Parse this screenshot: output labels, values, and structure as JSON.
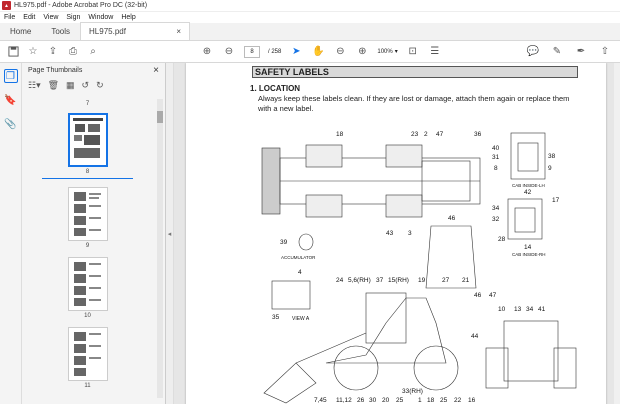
{
  "window": {
    "title": "HL975.pdf - Adobe Acrobat Pro DC (32-bit)",
    "app_icon": "pdf-icon"
  },
  "menu": [
    "File",
    "Edit",
    "View",
    "Sign",
    "Window",
    "Help"
  ],
  "tabs": {
    "home": "Home",
    "tools": "Tools",
    "doc": "HL975.pdf",
    "close": "×"
  },
  "toolbar": {
    "page_current": "8",
    "page_total": "/ 258",
    "zoom": "100%"
  },
  "thumbnails": {
    "title": "Page Thumbnails",
    "close": "×",
    "pages": [
      {
        "label": "7"
      },
      {
        "label": "8",
        "selected": true
      },
      {
        "label": "9"
      },
      {
        "label": "10"
      },
      {
        "label": "11"
      }
    ]
  },
  "page": {
    "section_title": "SAFETY LABELS",
    "location_heading": "1. LOCATION",
    "location_text": "Always keep these labels clean.  If they are lost or damage, attach them again or replace them with a new label.",
    "labels": {
      "n18a": "18",
      "n23": "23",
      "n2": "2",
      "n47a": "47",
      "n36": "36",
      "n40": "40",
      "n31": "31",
      "n8": "8",
      "n38": "38",
      "n9": "9",
      "cab_lh": "CAB INSIDE-LH",
      "n42": "42",
      "n34": "34",
      "n17": "17",
      "n32": "32",
      "n28": "28",
      "n14": "14",
      "cab_rh": "CAB INSIDE-RH",
      "n46a": "46",
      "n43": "43",
      "n3": "3",
      "n39": "39",
      "accumulator": "ACCUMULATOR",
      "n4": "4",
      "n35": "35",
      "view_a": "VIEW A",
      "n24": "24",
      "n56": "5,6(RH)",
      "n37": "37",
      "n15": "15(RH)",
      "n19": "19",
      "n27": "27",
      "n21": "21",
      "n46b": "46",
      "n47b": "47",
      "n10": "10",
      "n13": "13",
      "n34b": "34",
      "n41": "41",
      "n44": "44",
      "n33": "33(RH)",
      "n745": "7,45",
      "n1112": "11,12",
      "n26": "26",
      "n30": "30",
      "n20": "20",
      "n25": "25",
      "n1": "1",
      "n18b": "18",
      "n25b": "25",
      "n22": "22",
      "n16": "16"
    }
  }
}
